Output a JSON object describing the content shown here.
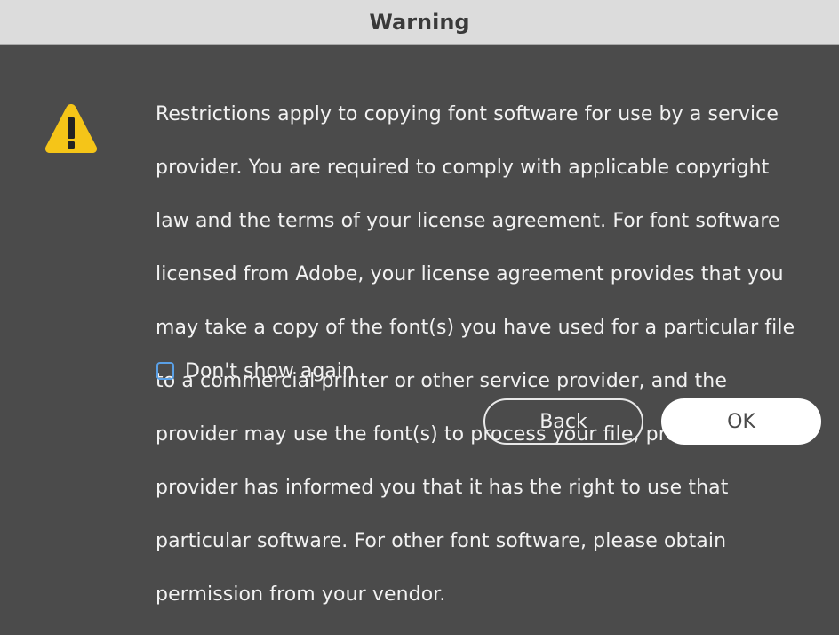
{
  "window": {
    "title": "Warning"
  },
  "icon": {
    "name": "warning-triangle-icon",
    "fill_color": "#f5c518",
    "glyph_color": "#222222"
  },
  "message": {
    "lines": [
      "Restrictions apply to copying font software for use by a service",
      "provider.  You are required to comply with applicable copyright",
      "law and the terms of your license agreement.  For font software",
      "licensed from Adobe, your license agreement provides that you",
      "may take a copy of the font(s) you have used for a particular file",
      "to a commercial printer or other service provider, and the",
      "provider may use the font(s) to process your file, provided the",
      "provider has informed you that it has the right to use that",
      "particular software.  For other font software, please obtain",
      "permission from your vendor."
    ]
  },
  "checkbox": {
    "label": "Don't show again",
    "checked": false
  },
  "buttons": {
    "back_label": "Back",
    "ok_label": "OK"
  },
  "colors": {
    "background": "#4b4b4b",
    "titlebar": "#dcdcdc",
    "checkbox_accent": "#5aa0e6"
  }
}
